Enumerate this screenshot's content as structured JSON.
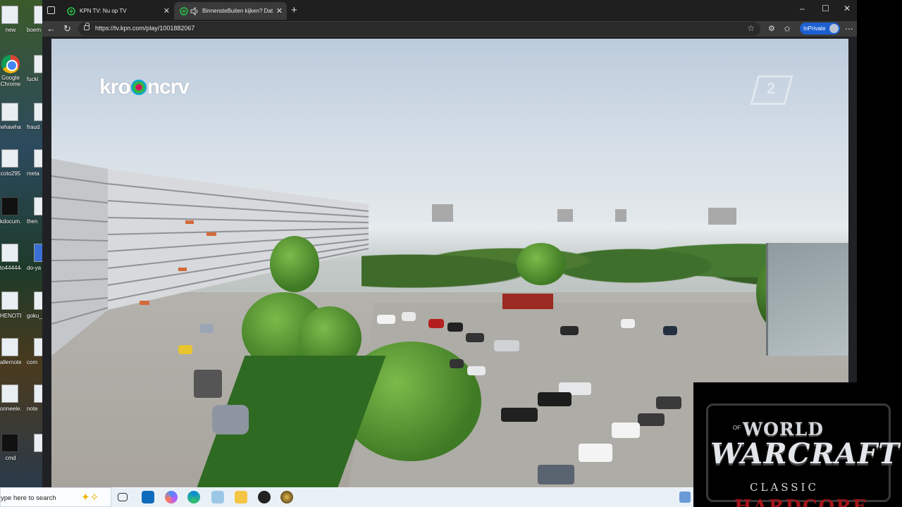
{
  "desktop": {
    "icons": [
      {
        "label": "new",
        "label2": "boem"
      },
      {
        "label": "Google Chrome",
        "label2": "fucki"
      },
      {
        "label": "whawha",
        "label2": "fraud"
      },
      {
        "label": "coto295",
        "label2": "meta"
      },
      {
        "label": "kdocum...",
        "label2": "then"
      },
      {
        "label": "to444444",
        "label2": "do-ya"
      },
      {
        "label": "HENOTE",
        "label2": "goku_"
      },
      {
        "label": "allernote",
        "label2": "com"
      },
      {
        "label": "onneele...",
        "label2": "note"
      },
      {
        "label": "cmd",
        "label2": ""
      }
    ]
  },
  "browser": {
    "tabs": [
      {
        "title": "KPN TV: Nu op TV"
      },
      {
        "title": "BinnensteBuiten kijken? Dat"
      }
    ],
    "url": "https://tv.kpn.com/play/1001882067",
    "inprivate_label": "InPrivate",
    "new_tab_glyph": "+",
    "window_controls": {
      "minimize": "–",
      "maximize": "☐",
      "close": "✕"
    }
  },
  "video": {
    "channel_logo": "kro ncrv",
    "channel_logo_left": "kro",
    "channel_logo_right": "ncrv",
    "network_logo": "2"
  },
  "overlay": {
    "line1": "WORLD",
    "of": "OF",
    "line2": "WARCRAFT",
    "line3": "CLASSIC",
    "line4": "HARDCORE"
  },
  "taskbar": {
    "search_placeholder": "ype here to search",
    "pinned": [
      "task-view-icon",
      "outlook-icon",
      "copilot-icon",
      "edge-icon",
      "notepad-icon",
      "file-explorer-icon",
      "app-icon",
      "wow-icon"
    ]
  },
  "colors": {
    "tab_bg": "#1f1f1f",
    "active_tab": "#3a3a3a",
    "inprivate": "#1c5fd1",
    "hardcore_red": "#a3141a"
  }
}
